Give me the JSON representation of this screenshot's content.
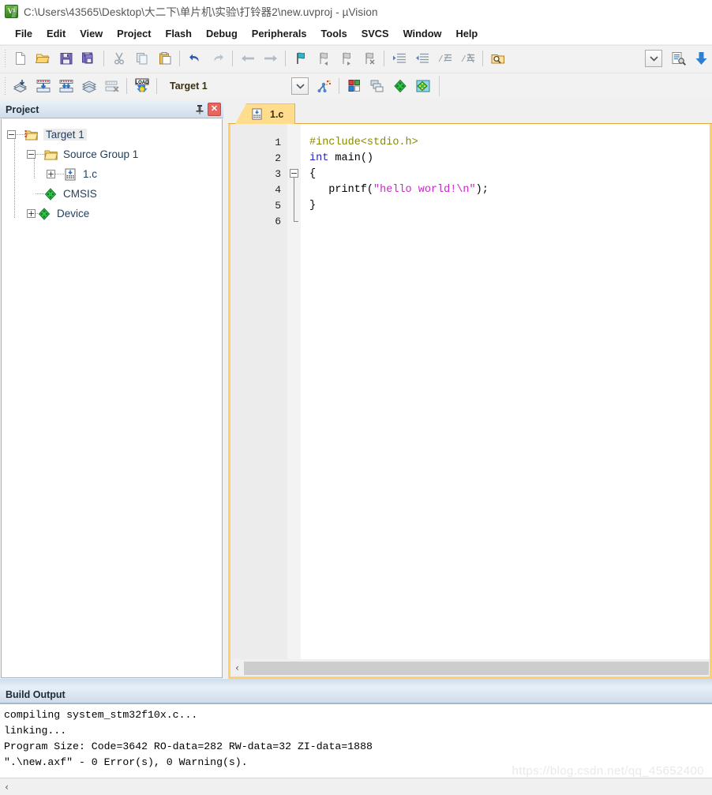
{
  "window": {
    "title": "C:\\Users\\43565\\Desktop\\大二下\\单片机\\实验\\打铃器2\\new.uvproj - µVision",
    "app_icon": "uvision-logo-icon"
  },
  "menubar": {
    "items": [
      {
        "label": "File"
      },
      {
        "label": "Edit"
      },
      {
        "label": "View"
      },
      {
        "label": "Project"
      },
      {
        "label": "Flash"
      },
      {
        "label": "Debug"
      },
      {
        "label": "Peripherals"
      },
      {
        "label": "Tools"
      },
      {
        "label": "SVCS"
      },
      {
        "label": "Window"
      },
      {
        "label": "Help"
      }
    ]
  },
  "toolbar_file": {
    "buttons": [
      {
        "name": "new-file-icon",
        "tip": "New"
      },
      {
        "name": "open-file-icon",
        "tip": "Open"
      },
      {
        "name": "save-icon",
        "tip": "Save"
      },
      {
        "name": "save-all-icon",
        "tip": "Save All"
      },
      {
        "name": "cut-icon",
        "tip": "Cut"
      },
      {
        "name": "copy-icon",
        "tip": "Copy"
      },
      {
        "name": "paste-icon",
        "tip": "Paste"
      },
      {
        "name": "undo-icon",
        "tip": "Undo"
      },
      {
        "name": "redo-icon",
        "tip": "Redo"
      },
      {
        "name": "navigate-back-icon",
        "tip": "Back"
      },
      {
        "name": "navigate-forward-icon",
        "tip": "Forward"
      },
      {
        "name": "insert-bookmark-icon",
        "tip": "Insert/Remove Bookmark"
      },
      {
        "name": "previous-bookmark-icon",
        "tip": "Previous Bookmark"
      },
      {
        "name": "next-bookmark-icon",
        "tip": "Next Bookmark"
      },
      {
        "name": "clear-bookmarks-icon",
        "tip": "Clear All Bookmarks"
      },
      {
        "name": "indent-icon",
        "tip": "Indent Selection"
      },
      {
        "name": "outdent-icon",
        "tip": "Outdent Selection"
      },
      {
        "name": "comment-icon",
        "tip": "Comment Selection"
      },
      {
        "name": "uncomment-icon",
        "tip": "Uncomment Selection"
      },
      {
        "name": "find-icon",
        "tip": "Find"
      },
      {
        "name": "find-scope-dropdown-icon",
        "tip": "Find Scope"
      },
      {
        "name": "find-in-files-icon",
        "tip": "Find in Files"
      },
      {
        "name": "download-blue-arrow-icon",
        "tip": "Download"
      }
    ]
  },
  "toolbar_build": {
    "buttons": [
      {
        "name": "translate-icon",
        "tip": "Translate"
      },
      {
        "name": "build-icon",
        "tip": "Build"
      },
      {
        "name": "rebuild-icon",
        "tip": "Rebuild"
      },
      {
        "name": "batch-build-icon",
        "tip": "Batch Build"
      },
      {
        "name": "stop-build-icon",
        "tip": "Stop Build"
      },
      {
        "name": "load-download-icon",
        "tip": "Download"
      },
      {
        "name": "target-options-icon",
        "tip": "Options for Target"
      },
      {
        "name": "manage-project-items-icon",
        "tip": "Manage Project Items"
      },
      {
        "name": "manage-multi-project-icon",
        "tip": "Multi-Project"
      },
      {
        "name": "pack-installer-icon",
        "tip": "Pack Installer"
      },
      {
        "name": "manage-run-time-env-icon",
        "tip": "Manage Run-Time Environment"
      }
    ],
    "target_select": {
      "value": "Target 1",
      "options": [
        "Target 1"
      ]
    }
  },
  "project_panel": {
    "title": "Project",
    "pin_label": "",
    "close_label": "✕",
    "tree": [
      {
        "label": "Target 1",
        "depth": 0,
        "expander": "−",
        "icon": "project-target-folder-icon",
        "selected": true
      },
      {
        "label": "Source Group 1",
        "depth": 1,
        "expander": "−",
        "icon": "source-group-folder-icon",
        "selected": false
      },
      {
        "label": "1.c",
        "depth": 2,
        "expander": "+",
        "icon": "c-source-file-icon",
        "selected": false
      },
      {
        "label": "CMSIS",
        "depth": 1,
        "expander": "",
        "icon": "cmsis-component-icon",
        "selected": false
      },
      {
        "label": "Device",
        "depth": 1,
        "expander": "+",
        "icon": "device-component-icon",
        "selected": false
      }
    ]
  },
  "editor": {
    "tabs": [
      {
        "label": "1.c",
        "icon": "c-source-file-icon",
        "active": true
      }
    ],
    "lines": [
      {
        "num": "1",
        "fold": "",
        "tokens": [
          {
            "t": "#include<stdio.h>",
            "c": "pre"
          }
        ]
      },
      {
        "num": "2",
        "fold": "",
        "tokens": [
          {
            "t": "int",
            "c": "kw"
          },
          {
            "t": " main()",
            "c": "plain"
          }
        ]
      },
      {
        "num": "3",
        "fold": "start",
        "tokens": [
          {
            "t": "{",
            "c": "plain"
          }
        ]
      },
      {
        "num": "4",
        "fold": "mid",
        "tokens": [
          {
            "t": "   printf(",
            "c": "plain"
          },
          {
            "t": "\"hello world!\\n\"",
            "c": "str"
          },
          {
            "t": ");",
            "c": "plain"
          }
        ]
      },
      {
        "num": "5",
        "fold": "mid",
        "tokens": [
          {
            "t": "}",
            "c": "plain"
          }
        ]
      },
      {
        "num": "6",
        "fold": "end",
        "tokens": [
          {
            "t": "",
            "c": "plain"
          }
        ]
      }
    ],
    "hscroll_left_label": "‹"
  },
  "build_output": {
    "title": "Build Output",
    "lines": [
      "compiling system_stm32f10x.c...",
      "linking...",
      "Program Size: Code=3642 RO-data=282 RW-data=32 ZI-data=1888",
      "\".\\new.axf\" - 0 Error(s), 0 Warning(s)."
    ],
    "hscroll_left_label": "‹"
  },
  "watermark": {
    "text": "https://blog.csdn.net/qq_45652400"
  },
  "colors": {
    "tab_active": "#ffdd8c",
    "editor_border": "#ffcf6b",
    "caption_gradient_top": "#e8f0f8",
    "caption_gradient_bottom": "#cfdcea",
    "tree_text": "#1f3d5c",
    "preprocessor": "#8a8a00",
    "keyword": "#2323c8",
    "string": "#c828c8",
    "close_button": "#e8655e"
  }
}
